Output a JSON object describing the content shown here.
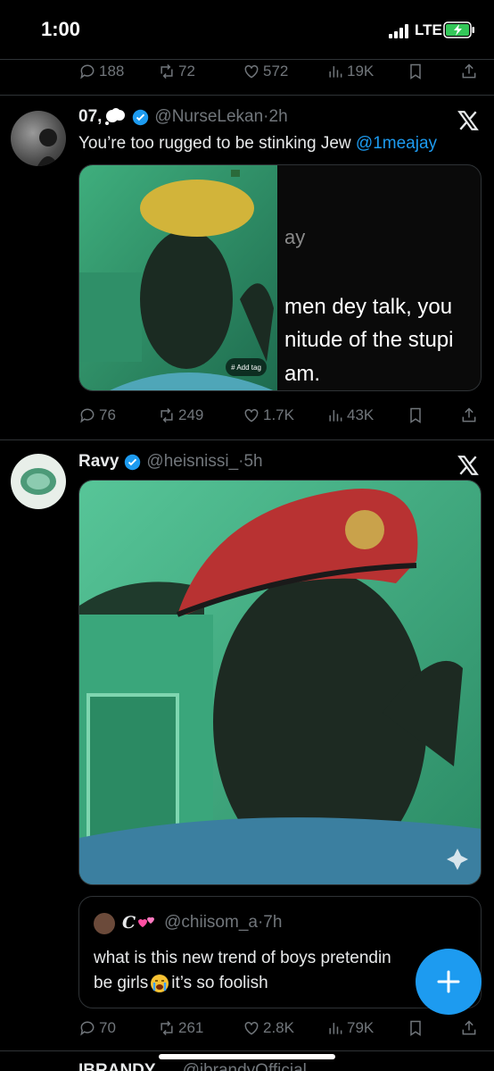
{
  "status_bar": {
    "time": "1:00",
    "network": "LTE"
  },
  "top_stats": {
    "replies": "188",
    "reposts": "72",
    "likes": "572",
    "views": "19K"
  },
  "tweets": [
    {
      "display_name": "07,",
      "handle": "@NurseLekan",
      "time": "2h",
      "text": "You’re too rugged to be stinking Jew ",
      "mention": "@1meajay",
      "media_text": {
        "line0": "ay",
        "line1": "men dey talk, you",
        "line2": "nitude of the stupi",
        "line3": "am.",
        "tag": "# Add tag"
      },
      "stats": {
        "replies": "76",
        "reposts": "249",
        "likes": "1.7K",
        "views": "43K"
      }
    },
    {
      "display_name": "Ravy",
      "handle": "@heisnissi_",
      "time": "5h",
      "quote": {
        "name": "C",
        "handle": "@chiisom_a",
        "time": "7h",
        "line1": "what is this new trend of boys pretendin",
        "line2": "be girls",
        "line2_rest": " it’s so foolish"
      },
      "stats": {
        "replies": "70",
        "reposts": "261",
        "likes": "2.8K",
        "views": "79K"
      }
    }
  ],
  "separator": "·",
  "partial_next": {
    "name": "IBRANDY",
    "handle": "@ibrandyOfficial"
  },
  "colors": {
    "accent": "#1d9bf0",
    "muted": "#71767b",
    "background": "#000000",
    "divider": "#2f3336"
  },
  "icons": [
    "reply-icon",
    "repost-icon",
    "like-icon",
    "views-icon",
    "bookmark-icon",
    "share-icon",
    "x-logo-icon",
    "verified-badge-icon",
    "compose-plus-icon"
  ]
}
